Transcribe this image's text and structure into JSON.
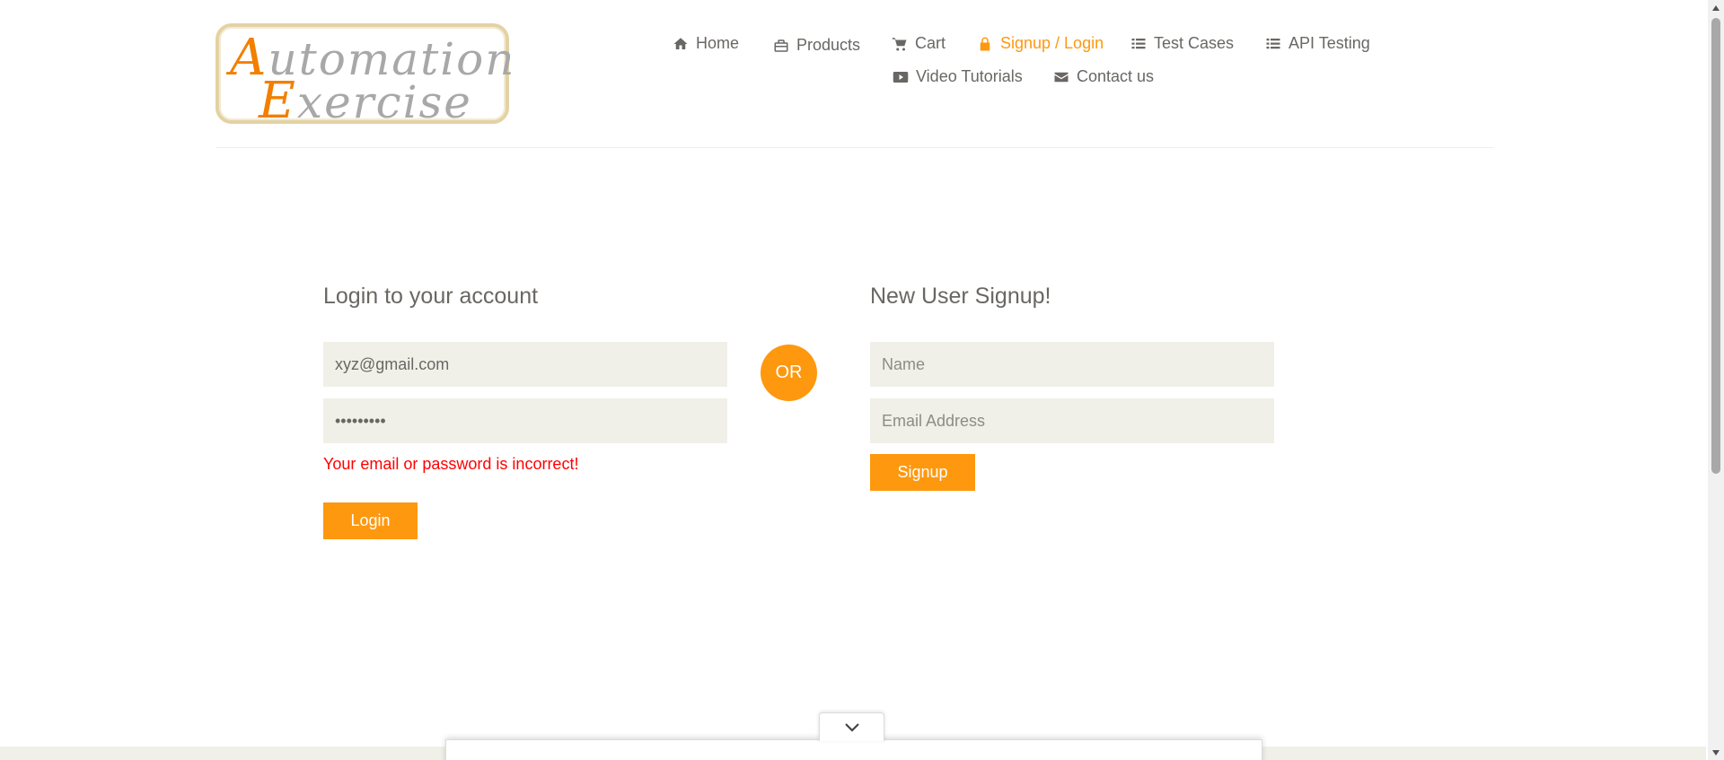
{
  "logo": {
    "cap1": "A",
    "rest1": "utomation",
    "cap2": "E",
    "rest2": "xercise"
  },
  "nav": {
    "home": "Home",
    "products": "Products",
    "cart": "Cart",
    "signup_login": "Signup / Login",
    "test_cases": "Test Cases",
    "api_testing": "API Testing",
    "video_tutorials": "Video Tutorials",
    "contact_us": "Contact us"
  },
  "login": {
    "title": "Login to your account",
    "email_value": "xyz@gmail.com",
    "password_value": "•••••••••",
    "error": "Your email or password is incorrect!",
    "button": "Login"
  },
  "divider": "OR",
  "signup": {
    "title": "New User Signup!",
    "name_placeholder": "Name",
    "email_placeholder": "Email Address",
    "button": "Signup"
  },
  "icons": {
    "home": "home-icon",
    "products": "briefcase-icon",
    "cart": "cart-icon",
    "signup_login": "lock-icon",
    "test_cases": "list-icon",
    "api_testing": "list-icon",
    "video_tutorials": "youtube-play-icon",
    "contact_us": "envelope-icon",
    "collapse": "chevron-down-icon"
  },
  "colors": {
    "accent": "#fe980f",
    "text": "#696763",
    "field_bg": "#f0f0e9",
    "error": "#ff0000"
  }
}
